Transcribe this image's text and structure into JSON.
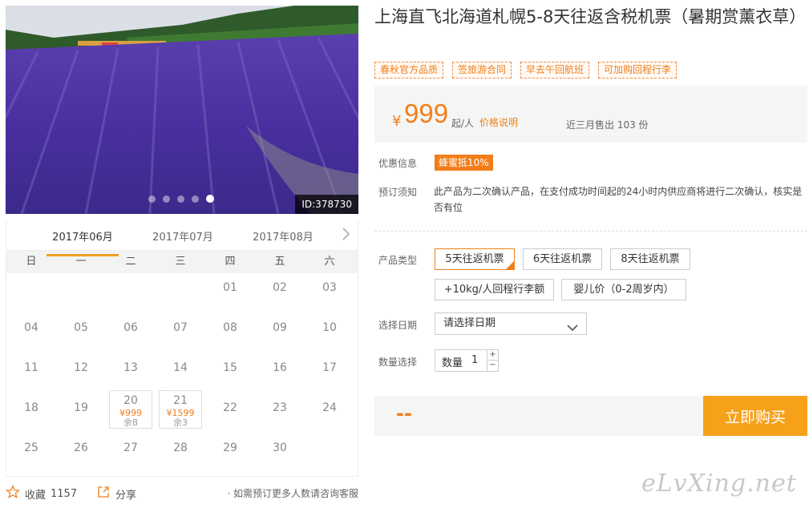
{
  "gallery": {
    "id_label": "ID:378730",
    "dots": 5,
    "active_dot": 4
  },
  "calendar": {
    "months": [
      "2017年06月",
      "2017年07月",
      "2017年08月"
    ],
    "active_month": 0,
    "weekdays": [
      "日",
      "一",
      "二",
      "三",
      "四",
      "五",
      "六"
    ],
    "leading_blanks": 4,
    "days": [
      {
        "d": "01"
      },
      {
        "d": "02"
      },
      {
        "d": "03"
      },
      {
        "d": "04"
      },
      {
        "d": "05"
      },
      {
        "d": "06"
      },
      {
        "d": "07"
      },
      {
        "d": "08"
      },
      {
        "d": "09"
      },
      {
        "d": "10"
      },
      {
        "d": "11"
      },
      {
        "d": "12"
      },
      {
        "d": "13"
      },
      {
        "d": "14"
      },
      {
        "d": "15"
      },
      {
        "d": "16"
      },
      {
        "d": "17"
      },
      {
        "d": "18"
      },
      {
        "d": "19"
      },
      {
        "d": "20",
        "price": "¥999",
        "left": "余8"
      },
      {
        "d": "21",
        "price": "¥1599",
        "left": "余3"
      },
      {
        "d": "22"
      },
      {
        "d": "23"
      },
      {
        "d": "24"
      },
      {
        "d": "25"
      },
      {
        "d": "26"
      },
      {
        "d": "27"
      },
      {
        "d": "28"
      },
      {
        "d": "29"
      },
      {
        "d": "30"
      }
    ]
  },
  "bottom": {
    "fav_label": "收藏",
    "fav_count": "1157",
    "share_label": "分享",
    "consult": "· 如需预订更多人数请咨询客服"
  },
  "product": {
    "title": "上海直飞北海道札幌5-8天往返含税机票（暑期赏薰衣草）",
    "tags": [
      "春秋官方品质",
      "签旅游合同",
      "早去午回航班",
      "可加购回程行李"
    ],
    "currency": "¥",
    "price": "999",
    "per": "起/人",
    "price_info": "价格说明",
    "sold": "近三月售出 103 份"
  },
  "promo": {
    "label": "优惠信息",
    "badge": "蜂蜜抵10%"
  },
  "notice": {
    "label": "预订须知",
    "text": "此产品为二次确认产品，在支付成功时间起的24小时内供应商将进行二次确认，核实是否有位"
  },
  "options": {
    "label": "产品类型",
    "items": [
      "5天往返机票",
      "6天往返机票",
      "8天往返机票",
      "+10kg/人回程行李额",
      "婴儿价（0-2周岁内）"
    ],
    "selected": 0
  },
  "date": {
    "label": "选择日期",
    "placeholder": "请选择日期"
  },
  "quantity": {
    "label": "数量选择",
    "field_label": "数量",
    "value": "1",
    "plus": "+",
    "minus": "−"
  },
  "buy": {
    "total": "--",
    "button": "立即购买"
  },
  "watermark": "eLvXing.net",
  "colors": {
    "accent": "#f27e1a",
    "button": "#f7a11a"
  }
}
